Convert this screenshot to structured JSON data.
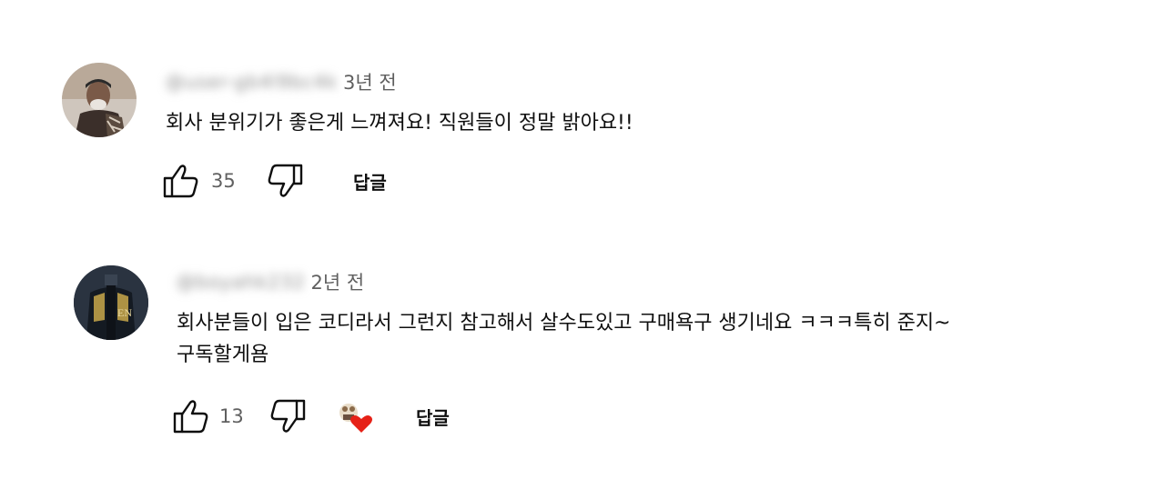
{
  "comments": [
    {
      "handle": "@user-gb4l9bc4k",
      "time": "3년 전",
      "text_lines": [
        "회사 분위기가 좋은게 느껴져요! 직원들이 정말 밝아요!!"
      ],
      "likes": "35",
      "reply_label": "답글"
    },
    {
      "handle": "@boyahk232",
      "time": "2년 전",
      "text_lines": [
        "회사분들이 입은 코디라서 그런지 참고해서 살수도있고 구매욕구 생기네요 ㅋㅋㅋ특히 준지~",
        "구독할게욤"
      ],
      "likes": "13",
      "reply_label": "답글",
      "creator_hearted": true
    }
  ],
  "icons": {
    "like": "thumbs-up-icon",
    "dislike": "thumbs-down-icon",
    "heart": "creator-heart-icon"
  },
  "colors": {
    "text": "#0f0f0f",
    "meta": "#606060",
    "heart": "#e62117"
  }
}
